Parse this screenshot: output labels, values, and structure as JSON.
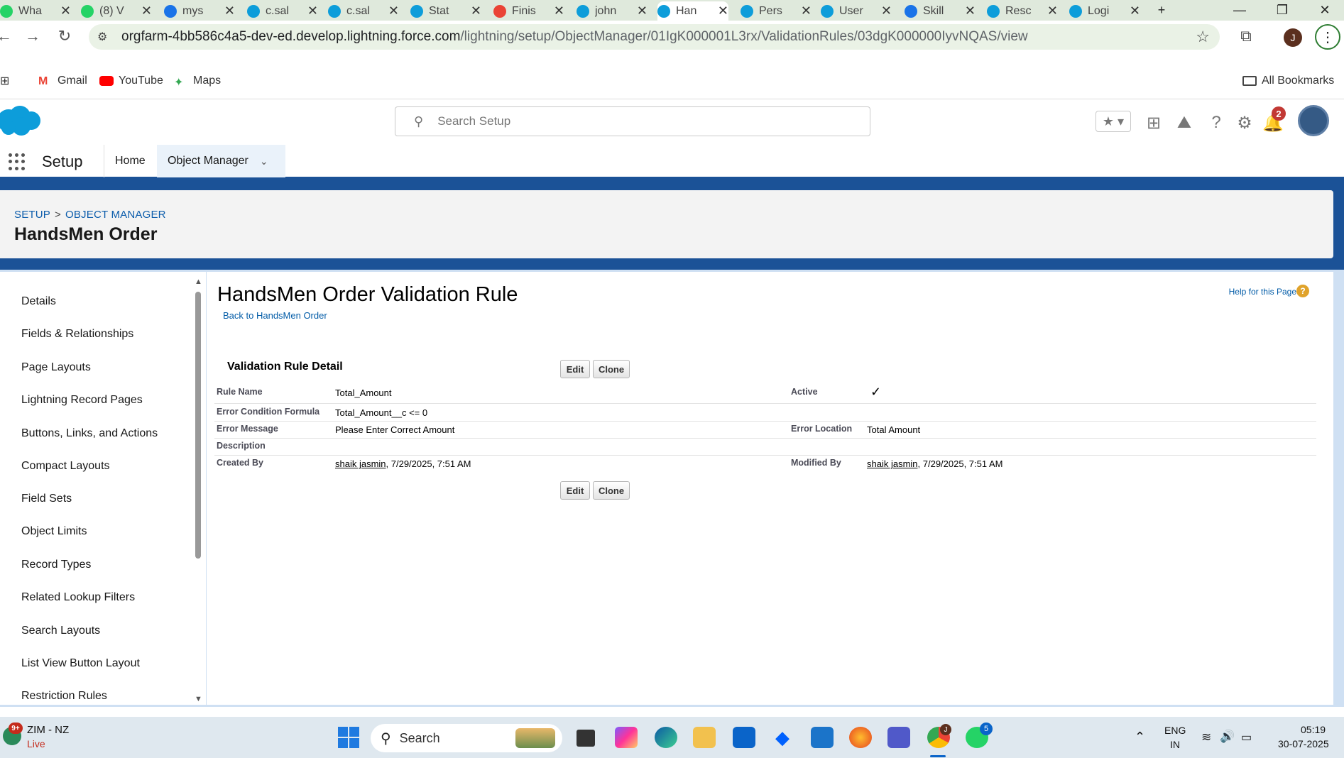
{
  "browser": {
    "tabs": [
      {
        "title": "Wha",
        "icon": "whatsapp-icon",
        "color": "#25d366"
      },
      {
        "title": "(8) V",
        "icon": "whatsapp-icon",
        "color": "#25d366"
      },
      {
        "title": "mys",
        "icon": "sw-icon",
        "color": "#1a73e8"
      },
      {
        "title": "c.sal",
        "icon": "salesforce-icon",
        "color": "#0d9dda"
      },
      {
        "title": "c.sal",
        "icon": "salesforce-icon",
        "color": "#0d9dda"
      },
      {
        "title": "Stat",
        "icon": "salesforce-icon",
        "color": "#0d9dda"
      },
      {
        "title": "Finis",
        "icon": "gmail-icon",
        "color": "#ea4335"
      },
      {
        "title": "john",
        "icon": "salesforce-icon",
        "color": "#0d9dda"
      },
      {
        "title": "Han",
        "icon": "salesforce-icon",
        "color": "#0d9dda"
      },
      {
        "title": "Pers",
        "icon": "salesforce-icon",
        "color": "#0d9dda"
      },
      {
        "title": "User",
        "icon": "salesforce-icon",
        "color": "#0d9dda"
      },
      {
        "title": "Skill",
        "icon": "sw-icon",
        "color": "#1a73e8"
      },
      {
        "title": "Resc",
        "icon": "salesforce-icon",
        "color": "#0d9dda"
      },
      {
        "title": "Logi",
        "icon": "salesforce-icon",
        "color": "#0d9dda"
      }
    ],
    "active_tab_index": 8,
    "url_host": "orgfarm-4bb586c4a5-dev-ed.develop.lightning.force.com",
    "url_path": "/lightning/setup/ObjectManager/01IgK000001L3rx/ValidationRules/03dgK000000IyvNQAS/view",
    "profile_initial": "J",
    "bookmarks": [
      "Gmail",
      "YouTube",
      "Maps"
    ],
    "all_bookmarks": "All Bookmarks"
  },
  "sf_header": {
    "search_placeholder": "Search Setup",
    "notification_count": "2"
  },
  "context_nav": {
    "app_name": "Setup",
    "tabs": [
      "Home",
      "Object Manager"
    ]
  },
  "object_header": {
    "crumb_setup": "SETUP",
    "crumb_sep": ">",
    "crumb_object_manager": "OBJECT MANAGER",
    "title": "HandsMen Order"
  },
  "left_nav": {
    "items": [
      "Details",
      "Fields & Relationships",
      "Page Layouts",
      "Lightning Record Pages",
      "Buttons, Links, and Actions",
      "Compact Layouts",
      "Field Sets",
      "Object Limits",
      "Record Types",
      "Related Lookup Filters",
      "Search Layouts",
      "List View Button Layout",
      "Restriction Rules"
    ]
  },
  "main": {
    "title": "HandsMen Order Validation Rule",
    "back_link": "Back to HandsMen Order",
    "help_link": "Help for this Page",
    "section_title": "Validation Rule Detail",
    "edit_label": "Edit",
    "clone_label": "Clone",
    "fields": {
      "rule_name_label": "Rule Name",
      "rule_name": "Total_Amount",
      "active_label": "Active",
      "active_mark": "✓",
      "formula_label": "Error Condition Formula",
      "formula": "Total_Amount__c <= 0",
      "error_message_label": "Error Message",
      "error_message": "Please Enter Correct Amount",
      "error_location_label": "Error Location",
      "error_location": "Total Amount",
      "description_label": "Description",
      "created_by_label": "Created By",
      "created_by_user": "shaik jasmin",
      "created_by_date": ", 7/29/2025, 7:51 AM",
      "modified_by_label": "Modified By",
      "modified_by_user": "shaik jasmin",
      "modified_by_date": ", 7/29/2025, 7:51 AM"
    }
  },
  "taskbar": {
    "weather_badge": "9+",
    "weather_title": "ZIM - NZ",
    "weather_sub": "Live",
    "search_label": "Search",
    "lang_top": "ENG",
    "lang_bottom": "IN",
    "time": "05:19",
    "date": "30-07-2025",
    "chrome_badge": "J",
    "whatsapp_badge": "5"
  }
}
